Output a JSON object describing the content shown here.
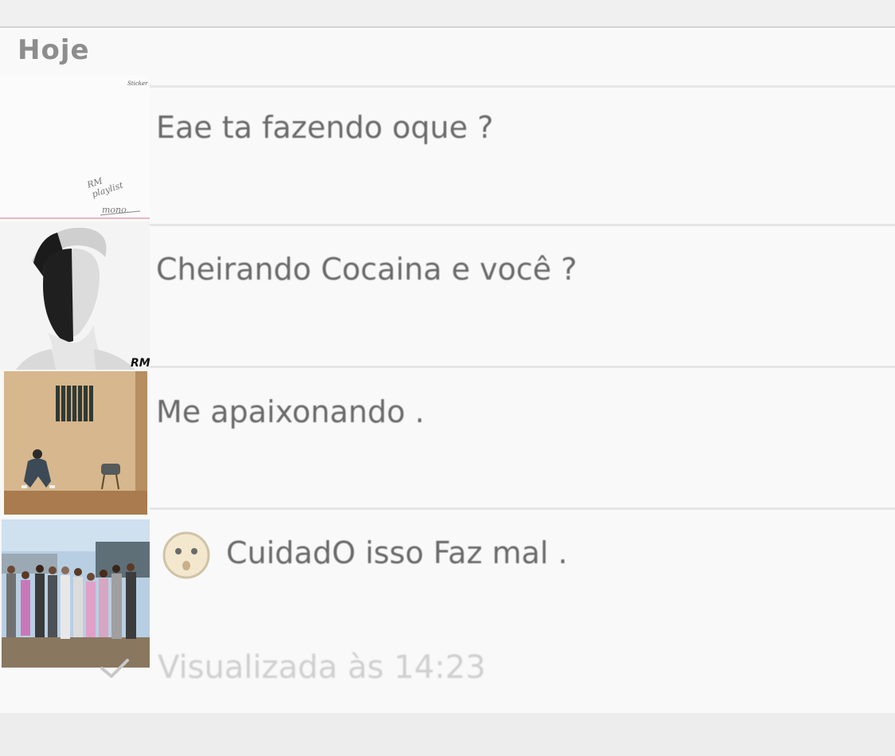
{
  "conversation": {
    "day_label": "Hoje",
    "messages": [
      {
        "text": "Eae ta fazendo oque ?",
        "avatar_icon": "album-cover-icon"
      },
      {
        "text": "Cheirando Cocaina e você ?",
        "avatar_icon": "portrait-photo-icon"
      },
      {
        "text": "Me apaixonando .",
        "avatar_icon": "room-photo-icon"
      },
      {
        "text": "CuidadO isso Faz mal .",
        "avatar_icon": "group-photo-icon",
        "emoji_icon": "worried-face-icon"
      }
    ],
    "status": {
      "text": "Visualizada às 14:23",
      "icon": "check-icon"
    }
  },
  "avatar_texts": {
    "cover1_corner": "Sticker",
    "cover1_line1": "RM",
    "cover1_line2": "playlist",
    "cover1_line3": "mono.",
    "cover2_initials": "RM"
  },
  "colors": {
    "background": "#f9f9f9",
    "text": "#6a6a6a",
    "status_text": "#cfcfcf",
    "separator": "#e6e6e6"
  }
}
